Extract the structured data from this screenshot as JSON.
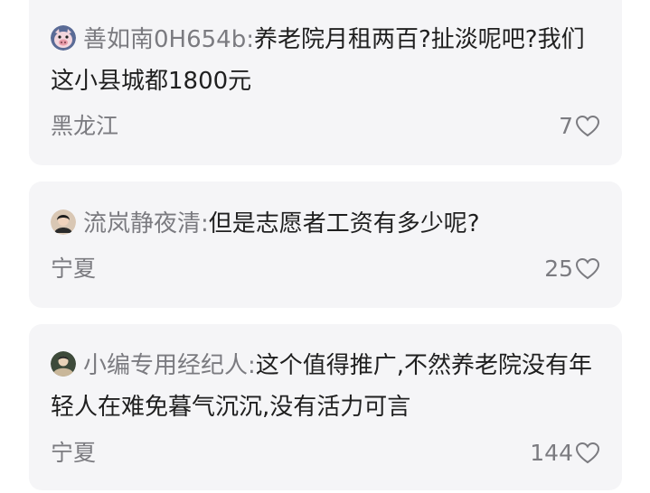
{
  "comments": [
    {
      "avatar_icon": "pig-avatar-icon",
      "author": "善如南0H654b",
      "separator": ":",
      "text": "养老院月租两百?扯淡呢吧?我们这小县城都1800元",
      "location": "黑龙江",
      "likes": "7",
      "like_icon": "heart-outline-icon"
    },
    {
      "avatar_icon": "user-photo-avatar-icon",
      "author": "流岚静夜清",
      "separator": ":",
      "text": "但是志愿者工资有多少呢?",
      "location": "宁夏",
      "likes": "25",
      "like_icon": "heart-outline-icon"
    },
    {
      "avatar_icon": "user-photo-avatar-icon",
      "author": "小编专用经纪人",
      "separator": ":",
      "text": "这个值得推广,不然养老院没有年轻人在难免暮气沉沉,没有活力可言",
      "location": "宁夏",
      "likes": "144",
      "like_icon": "heart-outline-icon"
    }
  ]
}
